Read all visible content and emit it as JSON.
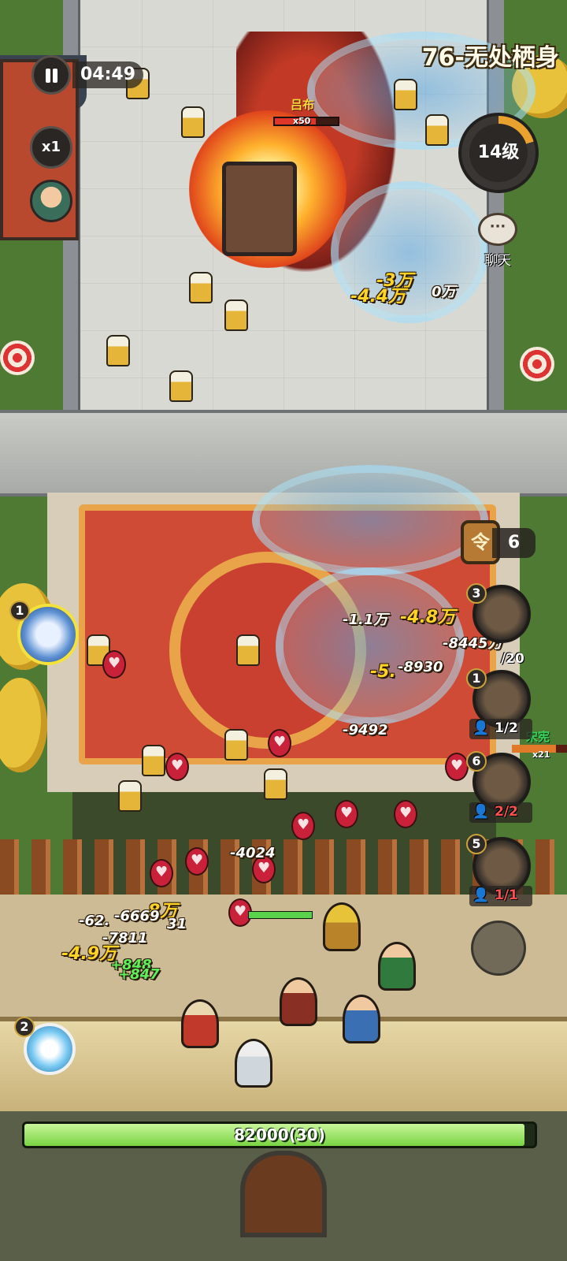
{
  "hud": {
    "timer": "04:49",
    "speed": "x1",
    "stage_title": "76-无处栖身",
    "level": "14级",
    "chat_label": "聊天"
  },
  "boss": {
    "name": "吕布",
    "multiplier": "x50"
  },
  "right_panel": {
    "token_count": "6",
    "skills": [
      {
        "badge": "3",
        "troops": "/20"
      },
      {
        "badge": "1",
        "troops": "1/2"
      },
      {
        "badge": "6",
        "troops": "2/2"
      },
      {
        "badge": "5",
        "troops": "1/1"
      }
    ]
  },
  "enemy_unit": {
    "name": "宋宪",
    "multiplier": "x21"
  },
  "left_skills": [
    {
      "badge": "1"
    },
    {
      "badge": "2"
    }
  ],
  "damage_numbers": [
    "-3万",
    "-4.4万",
    "0万",
    "-1.1万",
    "-4.8万",
    "-8445万",
    "-5.",
    "-8930",
    "-9492",
    "-4024",
    "8万",
    "-62.",
    "-6669",
    "31",
    "-7811",
    "-4.9万",
    "+848",
    "+847"
  ],
  "base_hp": {
    "label": "82000(30)",
    "fill_fraction": 0.98
  },
  "colors": {
    "gold_text": "#ffd324",
    "hp_green": "#7ad442",
    "boss_red": "#e0362a"
  }
}
